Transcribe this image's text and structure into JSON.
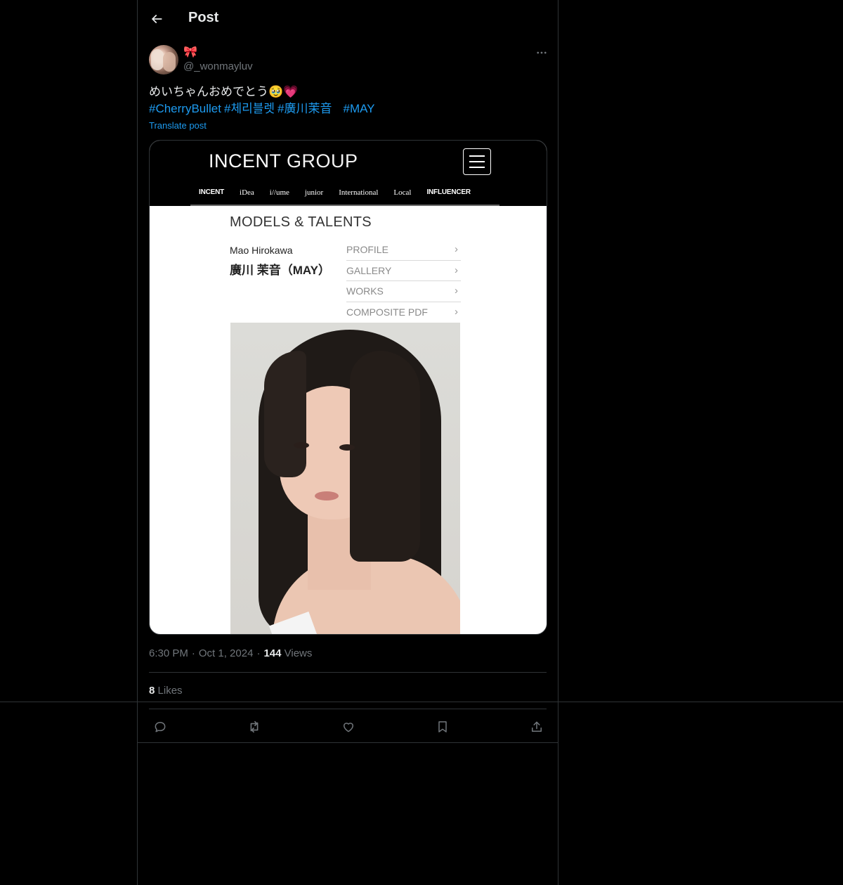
{
  "header": {
    "title": "Post"
  },
  "author": {
    "display_name": "🎀",
    "handle": "@_wonmayluv"
  },
  "post": {
    "text": "めいちゃんおめでとう🥹💗",
    "hashtags": [
      "#CherryBullet",
      "#체리블렛",
      "#廣川茉音",
      "#MAY"
    ],
    "translate_label": "Translate post"
  },
  "media": {
    "brand_bold": "INCENT",
    "brand_thin": "GROUP",
    "subnav": [
      "INCENT",
      "iDea",
      "i//ume",
      "junior",
      "International",
      "Local",
      "INFLUENCER"
    ],
    "section_title": "MODELS & TALENTS",
    "name_en": "Mao Hirokawa",
    "name_jp": "廣川 茉音（MAY）",
    "links": [
      "PROFILE",
      "GALLERY",
      "WORKS",
      "COMPOSITE PDF"
    ]
  },
  "meta": {
    "time": "6:30 PM",
    "date": "Oct 1, 2024",
    "views_count": "144",
    "views_label": "Views",
    "likes_count": "8",
    "likes_label": "Likes"
  },
  "actions": [
    "reply",
    "repost",
    "like",
    "bookmark",
    "share"
  ],
  "colors": {
    "background": "#000000",
    "text": "#e7e9ea",
    "secondary": "#71767b",
    "link": "#1d9bf0",
    "border": "#2f3336"
  }
}
